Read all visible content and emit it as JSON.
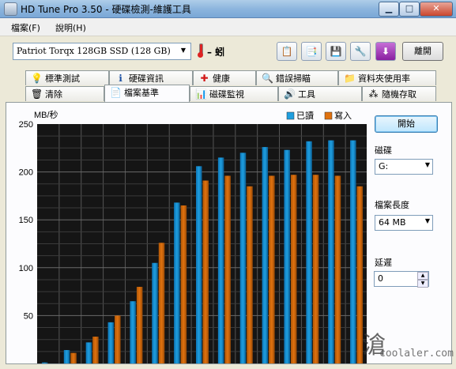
{
  "window": {
    "title": "HD Tune Pro 3.50 - 硬碟檢測-維護工具",
    "minimize": "▁",
    "maximize": "□",
    "close": "✕"
  },
  "menu": {
    "file": "檔案(F)",
    "help": "說明(H)"
  },
  "toolbar": {
    "drive": "Patriot Torqx 128GB SSD (128 GB)",
    "temperature": "– 蚓",
    "exit": "離開"
  },
  "tabs_top": [
    {
      "label": "標準測試",
      "icon": "lightbulb-icon",
      "glyph": "💡"
    },
    {
      "label": "硬碟資訊",
      "icon": "info-icon",
      "glyph": "ℹ"
    },
    {
      "label": "健康",
      "icon": "health-cross-icon",
      "glyph": "✚"
    },
    {
      "label": "錯誤掃瞄",
      "icon": "magnifier-icon",
      "glyph": "🔍"
    },
    {
      "label": "資料夾使用率",
      "icon": "folder-icon",
      "glyph": "📁"
    }
  ],
  "tabs_bottom": [
    {
      "label": "清除",
      "icon": "trash-icon",
      "glyph": "🗑"
    },
    {
      "label": "檔案基準",
      "icon": "file-benchmark-icon",
      "glyph": "📄"
    },
    {
      "label": "磁碟監視",
      "icon": "monitor-icon",
      "glyph": "📊"
    },
    {
      "label": "工具",
      "icon": "speaker-tools-icon",
      "glyph": "🔊"
    },
    {
      "label": "隨機存取",
      "icon": "random-access-icon",
      "glyph": "⁂"
    }
  ],
  "side": {
    "start": "開始",
    "disk_label": "磁碟",
    "disk_value": "G:",
    "file_length_label": "檔案長度",
    "file_length_value": "64 MB",
    "delay_label": "延遲",
    "delay_value": "0"
  },
  "chart_data": {
    "type": "bar",
    "ylabel": "MB/秒",
    "ylim": [
      0,
      250
    ],
    "yticks": [
      50,
      100,
      150,
      200,
      250
    ],
    "grid": true,
    "legend_position": "top-right",
    "series": [
      {
        "name": "已讀",
        "color": "#1f9fe0",
        "values": [
          1,
          14,
          22,
          43,
          65,
          105,
          168,
          206,
          215,
          220,
          226,
          223,
          232,
          233,
          233
        ]
      },
      {
        "name": "寫入",
        "color": "#e0720f",
        "values": [
          0,
          11,
          28,
          50,
          80,
          126,
          165,
          191,
          196,
          185,
          196,
          197,
          197,
          196,
          185
        ]
      }
    ]
  },
  "watermark": {
    "glyph": "滄",
    "site": "coolaler.com"
  }
}
